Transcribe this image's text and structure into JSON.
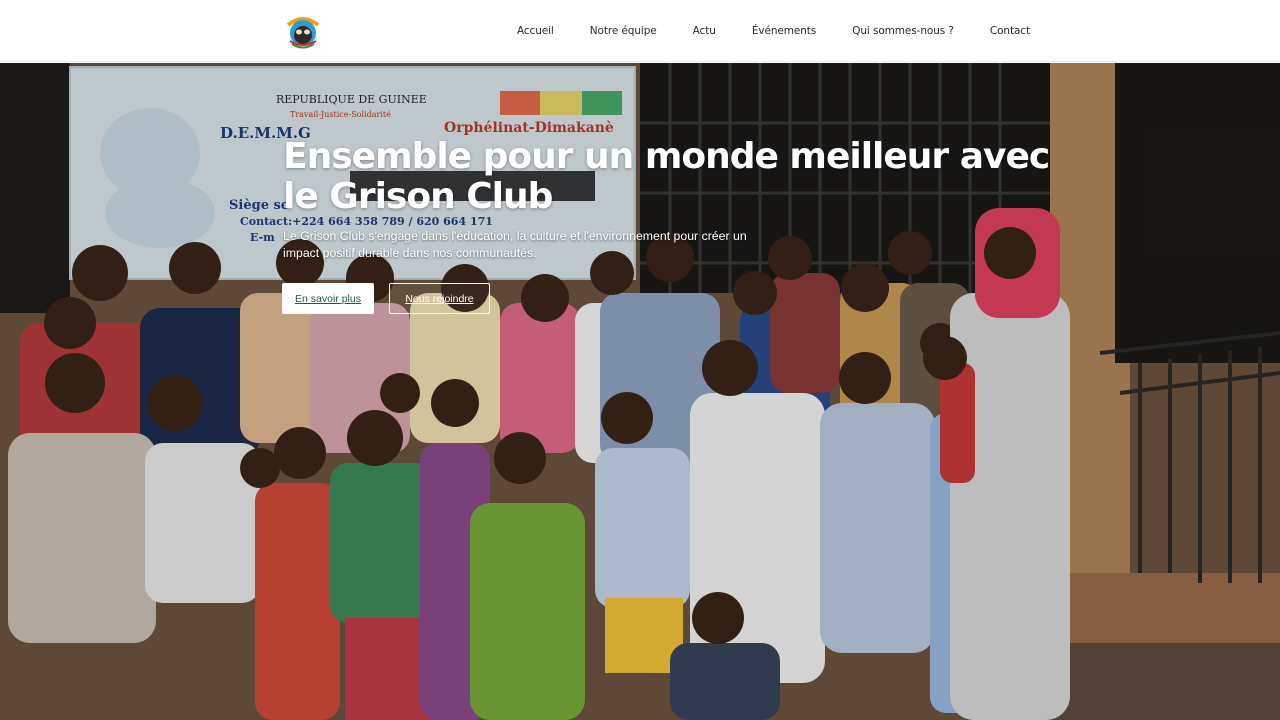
{
  "site": {
    "logo_icon": "grison-club-logo-icon",
    "colors": {
      "accent_green": "#1e5b3b",
      "nav_text": "#2b2b2b",
      "white": "#ffffff"
    }
  },
  "nav": {
    "items": [
      {
        "label": "Accueil"
      },
      {
        "label": "Notre équipe"
      },
      {
        "label": "Actu"
      },
      {
        "label": "Événements"
      },
      {
        "label": "Qui sommes-nous ?"
      },
      {
        "label": "Contact"
      }
    ]
  },
  "hero": {
    "title": "Ensemble pour un monde meilleur avec le Grison Club",
    "text": "Le Grison Club s'engage dans l'éducation, la culture et l'environnement pour créer un impact positif durable dans nos communautés.",
    "primary_button": "En savoir plus",
    "secondary_button": "Nous rejoindre",
    "banner": {
      "line1": "REPUBLIQUE DE GUINEE",
      "line2": "Travail-Justice-Solidarité",
      "line3": "D.E.M.M.G",
      "line4": "Orphélinat-Dimakanè",
      "line5": "Siège so",
      "line6": "Contact:+224 664 358 789 / 620 664 171",
      "line7": "E-m"
    }
  }
}
